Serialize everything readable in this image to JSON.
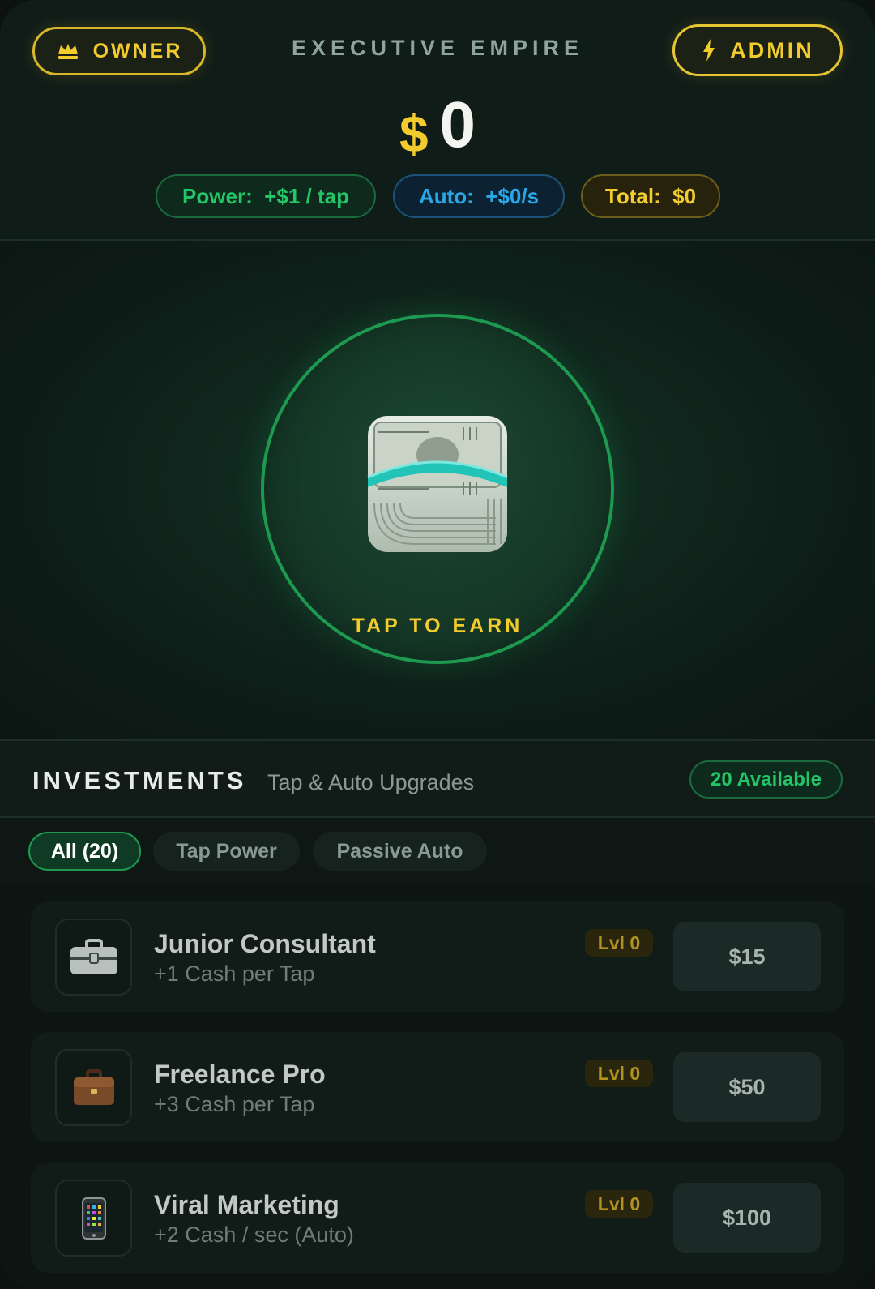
{
  "header": {
    "owner_label": "OWNER",
    "admin_label": "ADMIN",
    "title": "EXECUTIVE EMPIRE",
    "balance_symbol": "$",
    "balance_value": "0"
  },
  "stats": {
    "power": "Power:  +$1 / tap",
    "auto": "Auto:  +$0/s",
    "total": "Total:  $0"
  },
  "tap": {
    "label": "TAP TO EARN",
    "icon": "money-roll-icon"
  },
  "investments": {
    "title": "INVESTMENTS",
    "subtitle": "Tap & Auto Upgrades",
    "available_badge": "20 Available",
    "filters": [
      {
        "label": "All (20)",
        "active": true
      },
      {
        "label": "Tap Power",
        "active": false
      },
      {
        "label": "Passive Auto",
        "active": false
      }
    ],
    "items": [
      {
        "name": "Junior Consultant",
        "desc": "+1 Cash per Tap",
        "level": "Lvl 0",
        "price": "$15",
        "icon": "toolbox-icon"
      },
      {
        "name": "Freelance Pro",
        "desc": "+3 Cash per Tap",
        "level": "Lvl 0",
        "price": "$50",
        "icon": "briefcase-icon"
      },
      {
        "name": "Viral Marketing",
        "desc": "+2 Cash / sec (Auto)",
        "level": "Lvl 0",
        "price": "$100",
        "icon": "mobile-phone-icon"
      }
    ]
  },
  "colors": {
    "accent_gold": "#f2cc2c",
    "accent_green": "#24c566",
    "accent_blue": "#2aa7e6",
    "background": "#0f1a16"
  }
}
